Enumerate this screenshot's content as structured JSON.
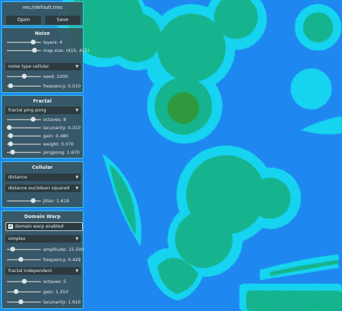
{
  "file": {
    "path": "res://default.tres",
    "open_label": "Open",
    "save_label": "Save"
  },
  "noise": {
    "title": "Noise",
    "layers_label": "layers: 4",
    "layers_value": 0.75,
    "mapsize_label": "map size: (415, 415)",
    "mapsize_value": 0.8,
    "type_selected": "noise type cellular",
    "seed_label": "seed: 1000",
    "seed_value": 0.5,
    "frequency_label": "frequency: 0.010",
    "frequency_value": 0.1
  },
  "fractal": {
    "title": "Fractal",
    "type_selected": "fractal ping pong",
    "octaves_label": "octaves: 8",
    "octaves_value": 0.75,
    "lacunarity_label": "lacunarity: 0.310",
    "lacunarity_value": 0.05,
    "gain_label": "gain: 0.480",
    "gain_value": 0.1,
    "weight_label": "weight: 0.070",
    "weight_value": 0.1,
    "pingpong_label": "pingpong: 1.670",
    "pingpong_value": 0.15
  },
  "cellular": {
    "title": "Cellular",
    "return_type_selected": "distance",
    "distance_function_selected": "distance euclidean squared",
    "jitter_label": "jitter: 1.619",
    "jitter_value": 0.75
  },
  "domain_warp": {
    "title": "Domain Warp",
    "enabled_label": "domain warp enabled",
    "enabled": true,
    "type_selected": "simplex",
    "amplitude_label": "amplitude: 15.500",
    "amplitude_value": 0.15,
    "frequency_label": "frequency: 0.429",
    "frequency_value": 0.4,
    "fractal_type_selected": "fractal independent",
    "octaves_label": "octaves: 5",
    "octaves_value": 0.5,
    "gain_label": "gain: 1.310",
    "gain_value": 0.25,
    "lacunarity_label": "lacunarity: 1.910",
    "lacunarity_value": 0.4
  },
  "colors": {
    "water": "#1e88f0",
    "shallow": "#17d4f0",
    "land": "#17b48e",
    "forest": "#2e9a3e",
    "panel_border": "#3ad0ee"
  },
  "icons": {
    "dropdown": "chevron-down-icon",
    "checkbox": "checkmark-icon"
  }
}
